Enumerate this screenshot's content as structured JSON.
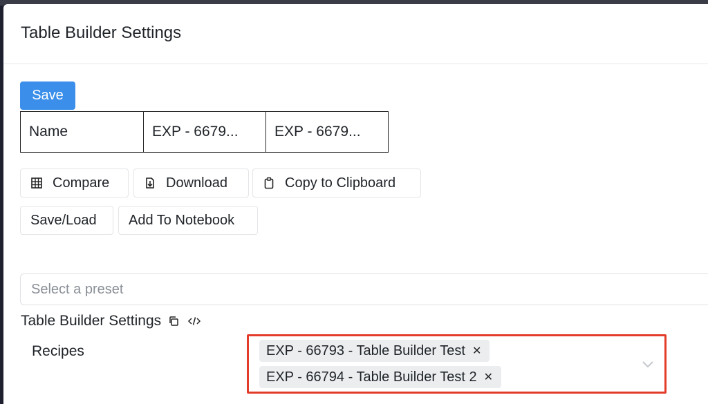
{
  "modal": {
    "title": "Table Builder Settings",
    "save_label": "Save"
  },
  "name_table": {
    "cells": [
      "Name",
      "EXP - 6679...",
      "EXP - 6679..."
    ]
  },
  "toolbar": {
    "compare_label": "Compare",
    "download_label": "Download",
    "copy_label": "Copy to Clipboard",
    "saveload_label": "Save/Load",
    "add_notebook_label": "Add To Notebook"
  },
  "preset": {
    "placeholder": "Select a preset"
  },
  "settings": {
    "label": "Table Builder Settings",
    "copy_icon": "copy-icon",
    "code_icon": "code-icon"
  },
  "recipes": {
    "label": "Recipes",
    "selected": [
      "EXP - 66793 - Table Builder Test",
      "EXP - 66794 - Table Builder Test 2"
    ]
  },
  "colors": {
    "primary": "#3b8fea",
    "highlight": "#e33c2b"
  }
}
